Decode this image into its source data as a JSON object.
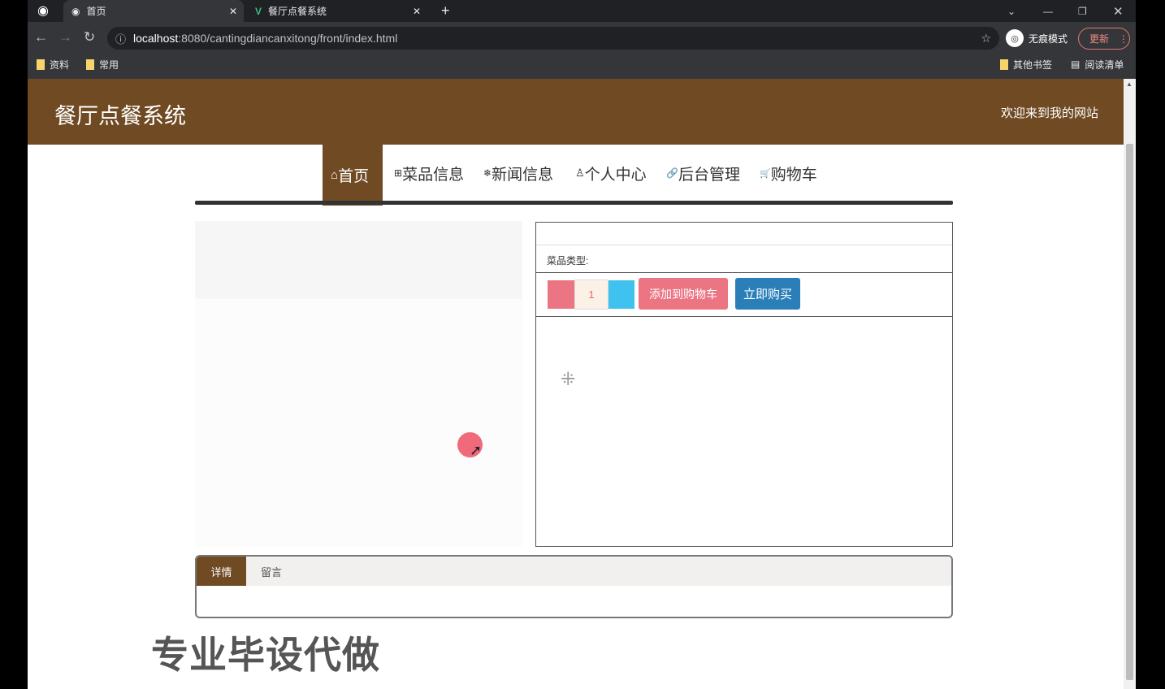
{
  "browser": {
    "tabs": [
      {
        "title": "首页",
        "icon": "globe-icon"
      },
      {
        "title": "餐厅点餐系统",
        "icon": "vue-icon"
      }
    ],
    "url_host": "localhost",
    "url_path": ":8080/cantingdiancanxitong/front/index.html",
    "incognito_label": "无痕模式",
    "update_label": "更新",
    "bookmarks": [
      "资料",
      "常用"
    ],
    "other_bookmarks": "其他书签",
    "reading_list": "阅读清单"
  },
  "site": {
    "title": "餐厅点餐系统",
    "welcome": "欢迎来到我的网站",
    "nav": [
      {
        "label": "首页",
        "icon": "⌂"
      },
      {
        "label": "菜品信息",
        "icon": "⊞"
      },
      {
        "label": "新闻信息",
        "icon": "❄"
      },
      {
        "label": "个人中心",
        "icon": "♙"
      },
      {
        "label": "后台管理",
        "icon": "🔗"
      },
      {
        "label": "购物车",
        "icon": "🛒"
      }
    ]
  },
  "detail": {
    "category_label": "菜品类型:",
    "quantity": "1",
    "add_to_cart": "添加到购物车",
    "buy_now": "立即购买"
  },
  "tabs": {
    "details": "详情",
    "comments": "留言"
  },
  "watermark": "专业毕设代做",
  "colors": {
    "brand": "#6f4a23",
    "cart": "#ec7584",
    "buy": "#2a7fb8"
  }
}
